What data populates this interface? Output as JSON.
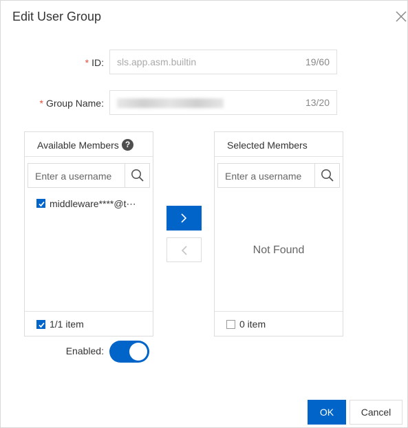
{
  "dialog": {
    "title": "Edit User Group",
    "close_icon": "close-icon"
  },
  "form": {
    "id": {
      "label": "ID:",
      "required_mark": "*",
      "value": "sls.app.asm.builtin",
      "counter": "19/60"
    },
    "group_name": {
      "label": "Group Name:",
      "required_mark": "*",
      "counter": "13/20"
    },
    "enabled": {
      "label": "Enabled:",
      "value": true
    }
  },
  "transfer": {
    "available": {
      "title": "Available Members",
      "help_icon": "?",
      "search_placeholder": "Enter a username",
      "items": [
        {
          "label": "middleware****@t⋯",
          "checked": true
        }
      ],
      "footer": "1/1 item",
      "footer_checked": true
    },
    "selected": {
      "title": "Selected Members",
      "search_placeholder": "Enter a username",
      "empty_text": "Not Found",
      "footer": "0 item",
      "footer_checked": false
    },
    "to_right_icon": "chevron-right-icon",
    "to_left_icon": "chevron-left-icon"
  },
  "actions": {
    "ok": "OK",
    "cancel": "Cancel"
  },
  "colors": {
    "primary": "#0064c8",
    "required": "#e84c3d"
  }
}
